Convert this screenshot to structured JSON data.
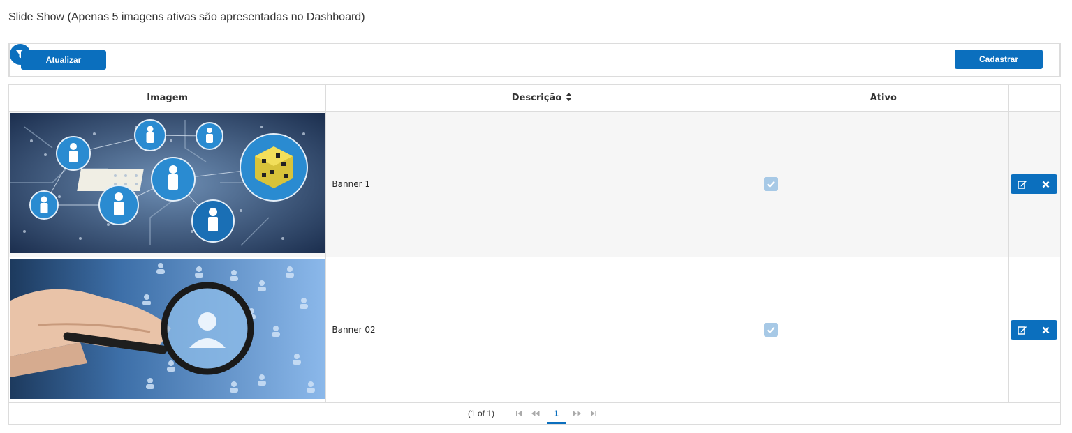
{
  "page": {
    "title": "Slide Show (Apenas 5 imagens ativas são apresentadas no Dashboard)"
  },
  "toolbar": {
    "refresh_label": "Atualizar",
    "filter_icon": "filter-icon",
    "register_label": "Cadastrar"
  },
  "table": {
    "columns": [
      "Imagem",
      "Descrição",
      "Ativo"
    ],
    "sort_icon": "sort-icon",
    "rows": [
      {
        "image": "circuit-board-network-image",
        "description": "Banner 1",
        "active": true
      },
      {
        "image": "magnifier-people-network-image",
        "description": "Banner 02",
        "active": true
      }
    ]
  },
  "pagination": {
    "current_report": "(1 of 1)",
    "pages": [
      "1"
    ],
    "active_page": "1"
  },
  "colors": {
    "primary": "#0b6fbe",
    "checkbox_disabled": "#a7c9e6",
    "border": "#dcdcdc",
    "row_stripe": "#f6f6f6"
  }
}
